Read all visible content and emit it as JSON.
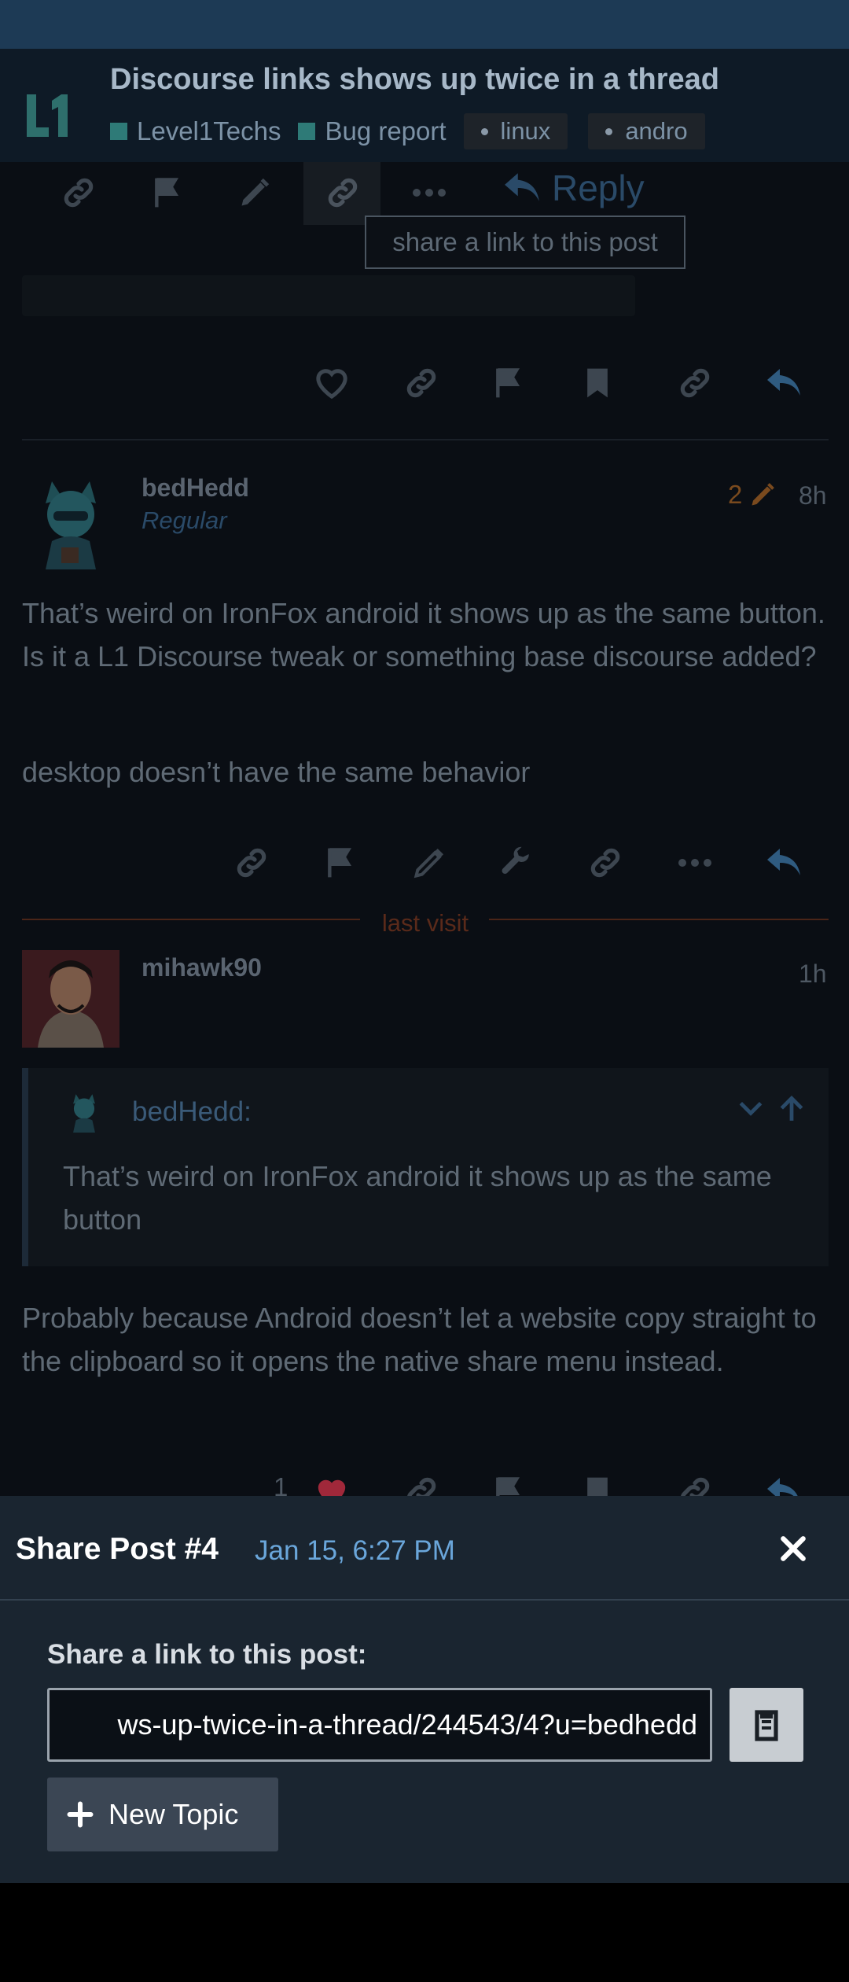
{
  "header": {
    "topic_title": "Discourse links shows up twice in a thread",
    "categories": [
      {
        "label": "Level1Techs",
        "color": "#2e7a77"
      },
      {
        "label": "Bug report",
        "color": "#2e7a77"
      }
    ],
    "tags": [
      "linux",
      "andro"
    ]
  },
  "post_top": {
    "reply_label": "Reply",
    "tooltip": "share a link to this post"
  },
  "post_bedhedd": {
    "username": "bedHedd",
    "user_title": "Regular",
    "edit_count": "2",
    "age": "8h",
    "paragraphs": [
      "That’s weird on IronFox android it shows up as the same button. Is it a L1 Discourse tweak or something base discourse added?",
      "desktop doesn’t have the same behavior"
    ]
  },
  "last_visit_label": "last visit",
  "post_mihawk": {
    "username": "mihawk90",
    "age": "1h",
    "quote_user": "bedHedd:",
    "quote_text": "That’s weird on IronFox android it shows up as the same button",
    "body": "Probably because Android doesn’t let a website copy straight to the clipboard so it opens the native share menu instead.",
    "like_count": "1"
  },
  "share_modal": {
    "title": "Share Post #4",
    "date": "Jan 15, 6:27 PM",
    "label": "Share a link to this post:",
    "url_value": "ws-up-twice-in-a-thread/244543/4?u=bedhedd",
    "new_topic_label": "New Topic"
  },
  "colors": {
    "accent": "#6aa6da",
    "category": "#2e7a77",
    "like_heart": "#a0283a",
    "edit_orange": "#7a4a1e"
  }
}
